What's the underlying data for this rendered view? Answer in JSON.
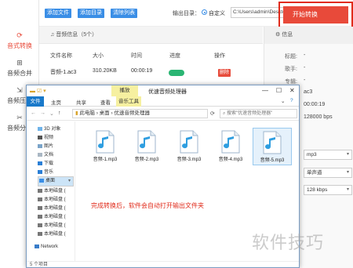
{
  "sidebar": {
    "items": [
      {
        "label": "音式转换",
        "icon": "convert-icon"
      },
      {
        "label": "音频合并",
        "icon": "merge-icon"
      },
      {
        "label": "音频压缩",
        "icon": "compress-icon"
      },
      {
        "label": "音频分割",
        "icon": "split-icon"
      }
    ]
  },
  "toolbar": {
    "add_file": "添加文件",
    "add_folder": "添加目录",
    "clear_list": "清除列表",
    "output_label": "输出目录：",
    "custom_label": "自定义",
    "output_path": "C:\\Users\\admin\\Deskto",
    "more": "···",
    "start": "开始转换"
  },
  "file_list": {
    "header": "音频信息（5个）",
    "columns": [
      "文件名称",
      "大小",
      "时间",
      "进度",
      "操作"
    ],
    "rows": [
      {
        "name": "音频-1.ac3",
        "size": "310.20KB",
        "time": "00:00:19",
        "action": "删除"
      }
    ]
  },
  "info_panel": {
    "header": "信息",
    "lines": [
      {
        "label": "标题:",
        "value": "-"
      },
      {
        "label": "歌手:",
        "value": "-"
      },
      {
        "label": "专辑:",
        "value": "-"
      }
    ],
    "format": "ac3",
    "duration": "00:00:19",
    "bitrate": "128000 bps",
    "out_format": "mp3",
    "channel": "单声道",
    "out_bitrate": "128 kbps"
  },
  "explorer": {
    "title": "优速音频处理器",
    "context_tab": "播放",
    "tabs": [
      "文件",
      "主页",
      "共享",
      "查看",
      "音乐工具"
    ],
    "address": [
      "此电脑",
      "桌面",
      "优速音频处理器"
    ],
    "search_placeholder": "搜索\"优速音频处理器\"",
    "nav_items": [
      "3D 对象",
      "视频",
      "图片",
      "文档",
      "下载",
      "音乐",
      "桌面",
      "本地磁盘 (",
      "本地磁盘 (",
      "本地磁盘 (",
      "本地磁盘 (",
      "本地磁盘 (",
      "本地磁盘 (",
      "Network"
    ],
    "files": [
      "音频-1.mp3",
      "音频-2.mp3",
      "音频-3.mp3",
      "音频-4.mp3",
      "音频-5.mp3"
    ],
    "note": "完成转换后，软件会自动打开输出文件夹",
    "status": "5 个项目"
  },
  "colors": {
    "accent_red": "#e84a3a",
    "accent_blue": "#3a8ee6",
    "progress_green": "#2ab573"
  },
  "watermark": "软件技巧"
}
